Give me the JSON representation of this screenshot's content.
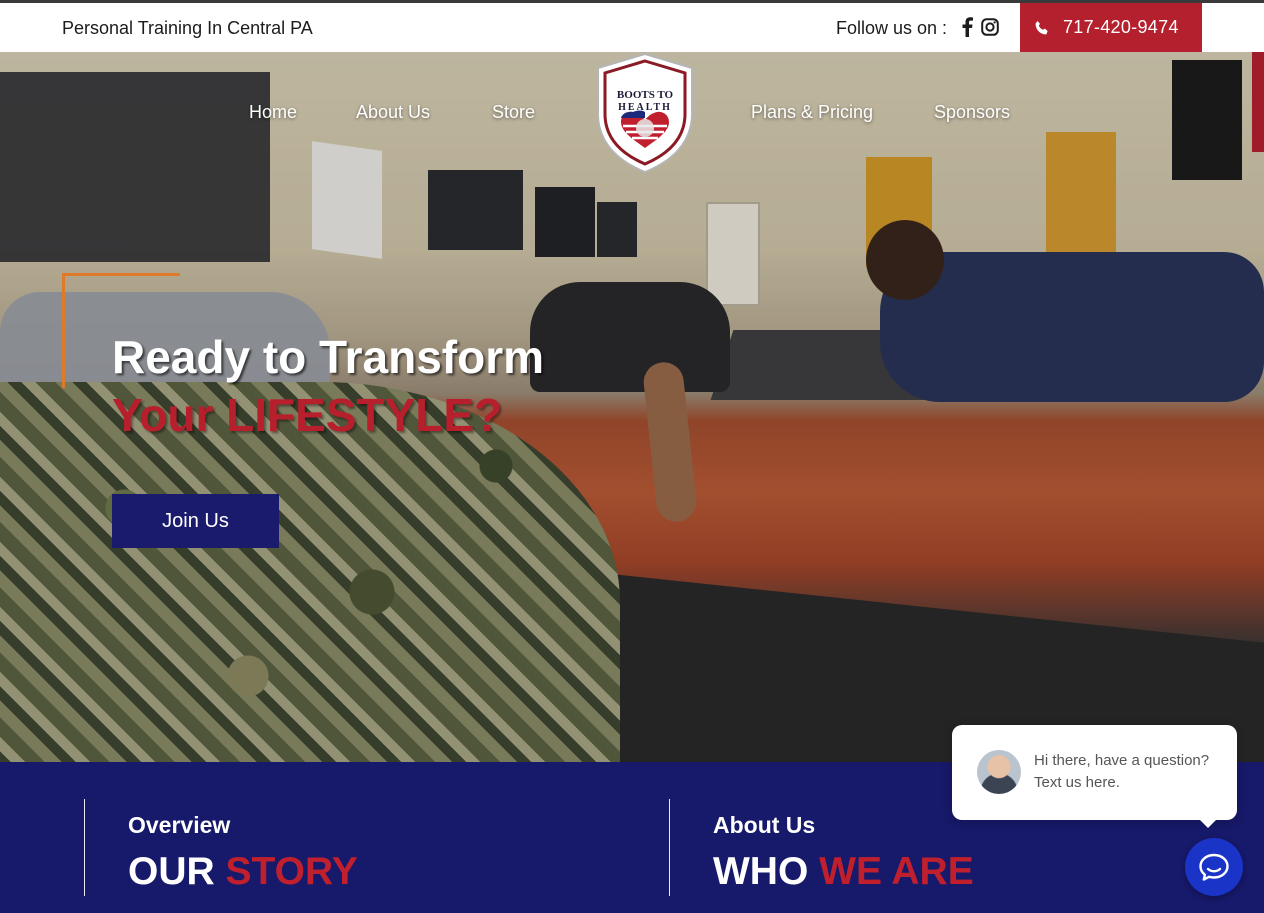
{
  "topbar": {
    "tagline": "Personal Training In Central PA",
    "follow_label": "Follow us on :",
    "phone": "717-420-9474"
  },
  "nav": {
    "home": "Home",
    "about": "About Us",
    "store": "Store",
    "plans": "Plans & Pricing",
    "sponsors": "Sponsors"
  },
  "logo": {
    "line1": "BOOTS TO",
    "line2": "HEALTH"
  },
  "hero": {
    "line1": "Ready to Transform",
    "line2": "Your LIFESTYLE?",
    "cta": "Join Us"
  },
  "sections": [
    {
      "kicker": "Overview",
      "title_a": "OUR",
      "title_b": "STORY"
    },
    {
      "kicker": "About Us",
      "title_a": "WHO",
      "title_b": "WE ARE"
    }
  ],
  "chat": {
    "message": "Hi there, have a question? Text us here."
  },
  "colors": {
    "brand_red": "#b4202d",
    "navy": "#17196a",
    "button_navy": "#1b1b6e",
    "chat_blue": "#1b34c8",
    "frame_orange": "#e07a2b"
  },
  "icons": [
    "facebook-icon",
    "instagram-icon",
    "phone-icon",
    "chat-icon"
  ]
}
